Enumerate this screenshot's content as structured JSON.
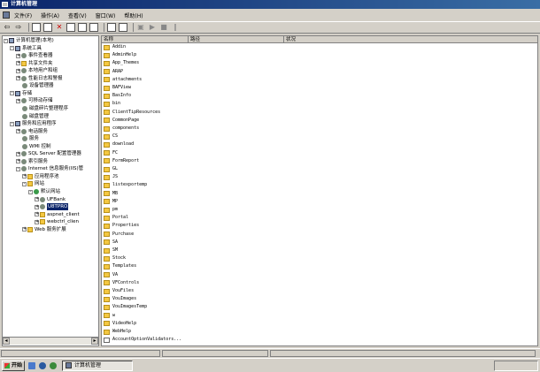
{
  "window": {
    "title": "计算机管理"
  },
  "menu": [
    "文件(F)",
    "操作(A)",
    "查看(V)",
    "窗口(W)",
    "帮助(H)"
  ],
  "columns": [
    "名称",
    "路径",
    "状况"
  ],
  "tree": [
    {
      "label": "计算机管理(本地)",
      "icon": "computer",
      "exp": "-"
    },
    {
      "label": "系统工具",
      "icon": "computer",
      "exp": "-"
    },
    {
      "label": "事件查看器",
      "icon": "gear",
      "exp": "+"
    },
    {
      "label": "共享文件夹",
      "icon": "folder",
      "exp": "+"
    },
    {
      "label": "本地用户和组",
      "icon": "gear",
      "exp": "+"
    },
    {
      "label": "性能日志和警报",
      "icon": "gear",
      "exp": "+"
    },
    {
      "label": "设备管理器",
      "icon": "gear",
      "exp": ""
    },
    {
      "label": "存储",
      "icon": "computer",
      "exp": "-"
    },
    {
      "label": "可移动存储",
      "icon": "gear",
      "exp": "+"
    },
    {
      "label": "磁盘碎片整理程序",
      "icon": "gear",
      "exp": ""
    },
    {
      "label": "磁盘管理",
      "icon": "gear",
      "exp": ""
    },
    {
      "label": "服务和应用程序",
      "icon": "computer",
      "exp": "-"
    },
    {
      "label": "电话服务",
      "icon": "gear",
      "exp": "+"
    },
    {
      "label": "服务",
      "icon": "gear",
      "exp": ""
    },
    {
      "label": "WMI 控制",
      "icon": "gear",
      "exp": ""
    },
    {
      "label": "SQL Server 配置管理器",
      "icon": "gear",
      "exp": "+"
    },
    {
      "label": "索引服务",
      "icon": "gear",
      "exp": "+"
    },
    {
      "label": "Internet 信息服务(IIS)管",
      "icon": "gear",
      "exp": "-"
    },
    {
      "label": "应用程序池",
      "icon": "folder",
      "exp": "+"
    },
    {
      "label": "网站",
      "icon": "folder",
      "exp": "-"
    },
    {
      "label": "默认网站",
      "icon": "globe",
      "exp": "-"
    },
    {
      "label": "UFBank",
      "icon": "gear",
      "exp": "+"
    },
    {
      "label": "U8TPRO",
      "icon": "gear",
      "exp": "+",
      "selected": true
    },
    {
      "label": "aspnet_client",
      "icon": "folder",
      "exp": "+"
    },
    {
      "label": "webctrl_clien",
      "icon": "folder",
      "exp": "+"
    },
    {
      "label": "Web 服务扩展",
      "icon": "folder",
      "exp": "+"
    }
  ],
  "files": [
    "Addin",
    "AdminHelp",
    "App_Themes",
    "ARAP",
    "attachments",
    "BAFView",
    "BasInfo",
    "bin",
    "ClientTipResources",
    "CommonPage",
    "components",
    "CS",
    "download",
    "FC",
    "FormReport",
    "GL",
    "JS",
    "listexportemp",
    "MB",
    "MP",
    "pm",
    "Portal",
    "Properties",
    "Purchase",
    "SA",
    "SM",
    "Stock",
    "Templates",
    "VA",
    "VFControls",
    "VouFiles",
    "VouImages",
    "VouImagesTemp",
    "w",
    "VideoHelp",
    "WebHelp",
    "AccountOptionValidators..."
  ],
  "taskbar": {
    "start": "开始",
    "task": "计算机管理"
  }
}
